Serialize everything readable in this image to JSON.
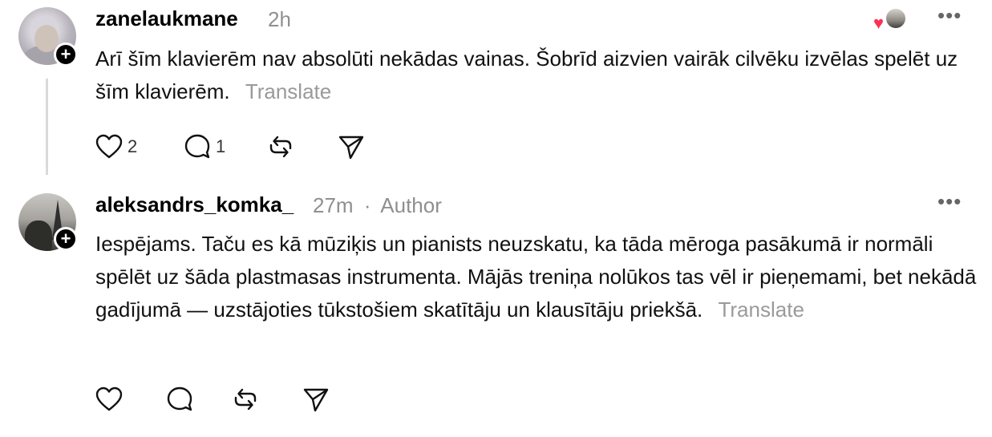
{
  "posts": [
    {
      "username": "zanelaukmane",
      "time": "2h",
      "text": "Arī šīm klavierēm nav absolūti nekādas vainas. Šobrīd aizvien vairāk cilvēku izvēlas spelēt uz šīm klavierēm.",
      "translate": "Translate",
      "likes": "2",
      "replies": "1",
      "has_reactor": true
    },
    {
      "username": "aleksandrs_komka_",
      "time": "27m",
      "separator": "·",
      "badge": "Author",
      "text": "Iespējams. Taču es kā mūziķis un pianists neuzskatu, ka tāda mēroga pasākumā ir normāli spēlēt uz šāda plastmasas instrumenta. Mājās treniņa nolūkos tas vēl ir pieņemami, bet nekādā gadījumā — uzstājoties tūkstošiem skatītāju un klausītāju priekšā.",
      "translate": "Translate",
      "likes": "",
      "replies": ""
    }
  ],
  "icons": {
    "more": "more-options-icon",
    "like": "heart-icon",
    "reply": "comment-icon",
    "repost": "repost-icon",
    "share": "send-icon",
    "follow": "plus-icon"
  },
  "colors": {
    "text": "#111111",
    "muted": "#8f8f8f",
    "heart": "#ff2f56"
  }
}
